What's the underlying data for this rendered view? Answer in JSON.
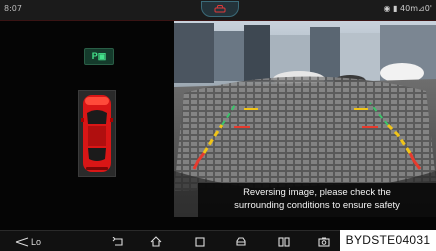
{
  "status_bar": {
    "clock": "8:07",
    "right_text": "40m⊿0'",
    "notif_icon": "car-icon"
  },
  "left_panel": {
    "gear": "P▣",
    "car_color": "#e01414"
  },
  "camera": {
    "notice_line1": "Reversing image, please check the",
    "notice_line2": "surrounding conditions to ensure safety",
    "guide_colors": {
      "near": "#e63b2e",
      "mid": "#f0c419"
    }
  },
  "nav_bar": {
    "lo_label": "Lo",
    "buttons": [
      "fan-icon",
      "back-icon",
      "home-icon",
      "recents-icon",
      "car-settings-icon",
      "split-screen-icon",
      "screenshot-icon"
    ]
  },
  "watermark": "BYDSTE04031"
}
